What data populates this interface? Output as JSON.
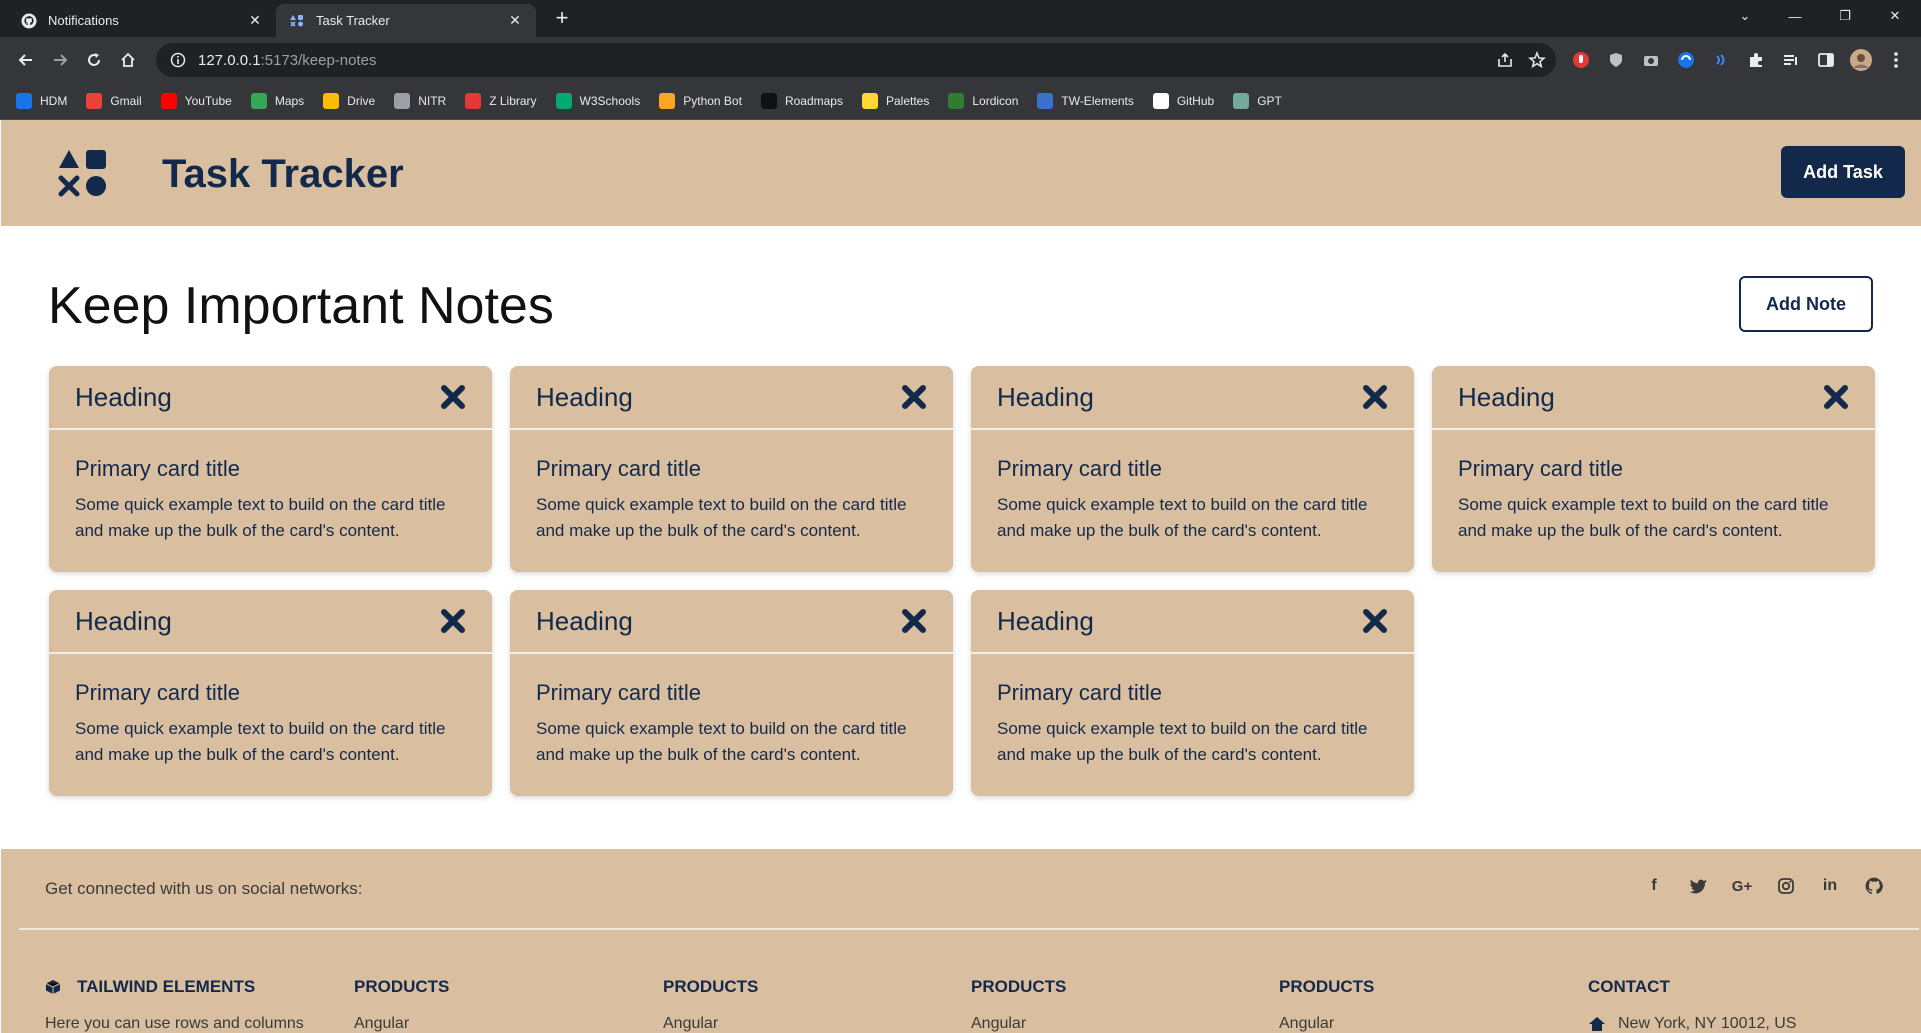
{
  "browser": {
    "tabs": [
      {
        "title": "Notifications",
        "active": false
      },
      {
        "title": "Task Tracker",
        "active": true
      }
    ],
    "url_host": "127.0.0.1",
    "url_rest": ":5173/keep-notes",
    "bookmarks": [
      {
        "label": "HDM",
        "icon": "hdm-icon",
        "color": "#1a73e8"
      },
      {
        "label": "Gmail",
        "icon": "gmail-icon",
        "color": "#ea4335"
      },
      {
        "label": "YouTube",
        "icon": "youtube-icon",
        "color": "#ff0000"
      },
      {
        "label": "Maps",
        "icon": "maps-icon",
        "color": "#34a853"
      },
      {
        "label": "Drive",
        "icon": "drive-icon",
        "color": "#fbbc04"
      },
      {
        "label": "NITR",
        "icon": "nitr-icon",
        "color": "#9aa0a6"
      },
      {
        "label": "Z Library",
        "icon": "zlibrary-icon",
        "color": "#e53935"
      },
      {
        "label": "W3Schools",
        "icon": "w3schools-icon",
        "color": "#04aa6d"
      },
      {
        "label": "Python Bot",
        "icon": "pythonbot-icon",
        "color": "#f9a825"
      },
      {
        "label": "Roadmaps",
        "icon": "roadmaps-icon",
        "color": "#111111"
      },
      {
        "label": "Palettes",
        "icon": "palettes-icon",
        "color": "#fdd835"
      },
      {
        "label": "Lordicon",
        "icon": "lordicon-icon",
        "color": "#2e7d32"
      },
      {
        "label": "TW-Elements",
        "icon": "twelements-icon",
        "color": "#3b71ca"
      },
      {
        "label": "GitHub",
        "icon": "github-icon",
        "color": "#ffffff"
      },
      {
        "label": "GPT",
        "icon": "gpt-icon",
        "color": "#74aa9c"
      }
    ]
  },
  "header": {
    "brand": "Task Tracker",
    "add_task_label": "Add Task"
  },
  "main": {
    "title": "Keep Important Notes",
    "add_note_label": "Add Note",
    "notes": [
      {
        "heading": "Heading",
        "title": "Primary card title",
        "text": "Some quick example text to build on the card title and make up the bulk of the card's content."
      },
      {
        "heading": "Heading",
        "title": "Primary card title",
        "text": "Some quick example text to build on the card title and make up the bulk of the card's content."
      },
      {
        "heading": "Heading",
        "title": "Primary card title",
        "text": "Some quick example text to build on the card title and make up the bulk of the card's content."
      },
      {
        "heading": "Heading",
        "title": "Primary card title",
        "text": "Some quick example text to build on the card title and make up the bulk of the card's content."
      },
      {
        "heading": "Heading",
        "title": "Primary card title",
        "text": "Some quick example text to build on the card title and make up the bulk of the card's content."
      },
      {
        "heading": "Heading",
        "title": "Primary card title",
        "text": "Some quick example text to build on the card title and make up the bulk of the card's content."
      },
      {
        "heading": "Heading",
        "title": "Primary card title",
        "text": "Some quick example text to build on the card title and make up the bulk of the card's content."
      }
    ]
  },
  "footer": {
    "social_text": "Get connected with us on social networks:",
    "social_icons": [
      "facebook-icon",
      "twitter-icon",
      "google-plus-icon",
      "instagram-icon",
      "linkedin-icon",
      "github-icon"
    ],
    "columns": [
      "TAILWIND ELEMENTS",
      "PRODUCTS",
      "PRODUCTS",
      "PRODUCTS",
      "PRODUCTS",
      "CONTACT"
    ],
    "contact_line": "New York, NY 10012, US",
    "column_sub": [
      "Here you can use rows and columns",
      "Angular",
      "Angular",
      "Angular",
      "Angular"
    ]
  },
  "colors": {
    "accent": "#13294b",
    "tan": "#d9bf9f"
  }
}
